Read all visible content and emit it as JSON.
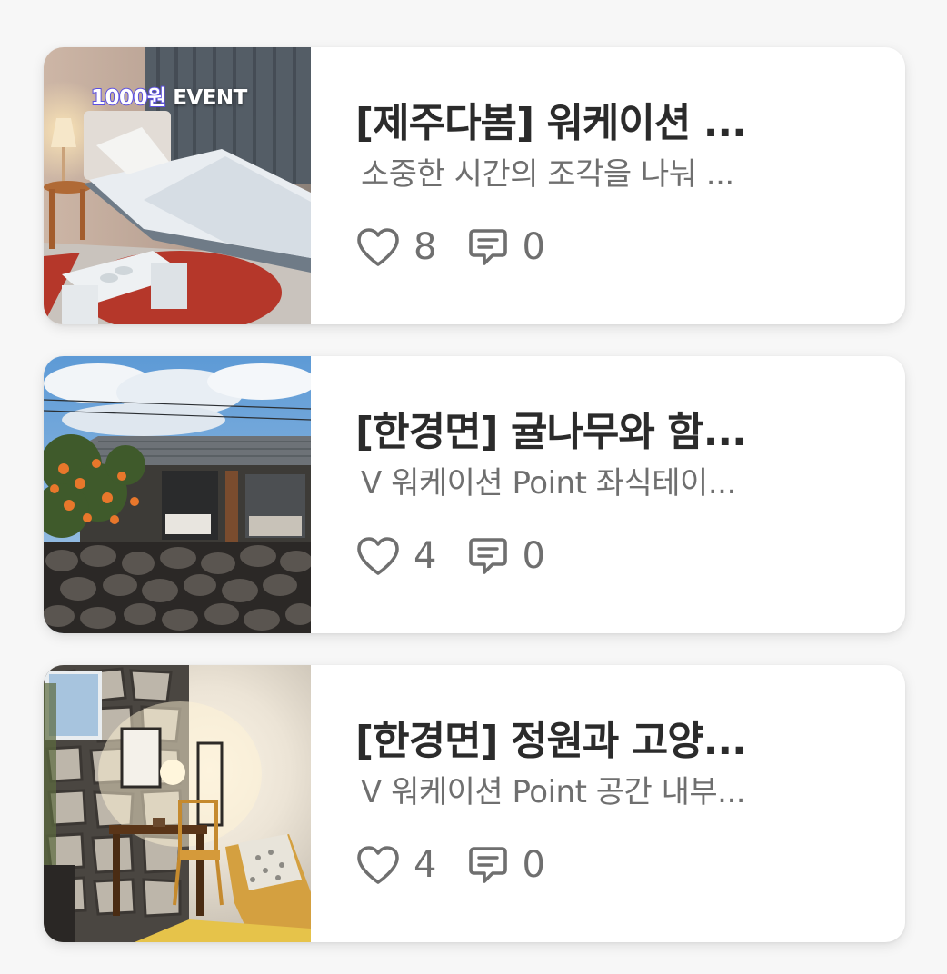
{
  "items": [
    {
      "badge": {
        "number": "1000원",
        "label": " EVENT"
      },
      "title": "[제주다봄] 워케이션 ...",
      "subtitle": "소중한 시간의 조각을 나눠 ...",
      "likes": "8",
      "comments": "0"
    },
    {
      "title": "[한경면] 귤나무와 함...",
      "subtitle": "ᐯ 워케이션 Point 좌식테이...",
      "likes": "4",
      "comments": "0"
    },
    {
      "title": "[한경면] 정원과 고양...",
      "subtitle": "ᐯ 워케이션 Point 공간 내부...",
      "likes": "4",
      "comments": "0"
    }
  ],
  "icons": {
    "like": "heart-icon",
    "comment": "comment-bubble-icon"
  },
  "colors": {
    "text_primary": "#2b2b2b",
    "text_secondary": "#6f6f6f",
    "badge_outline": "#5b4fe0",
    "card_bg": "#ffffff",
    "page_bg": "#f7f7f7"
  }
}
